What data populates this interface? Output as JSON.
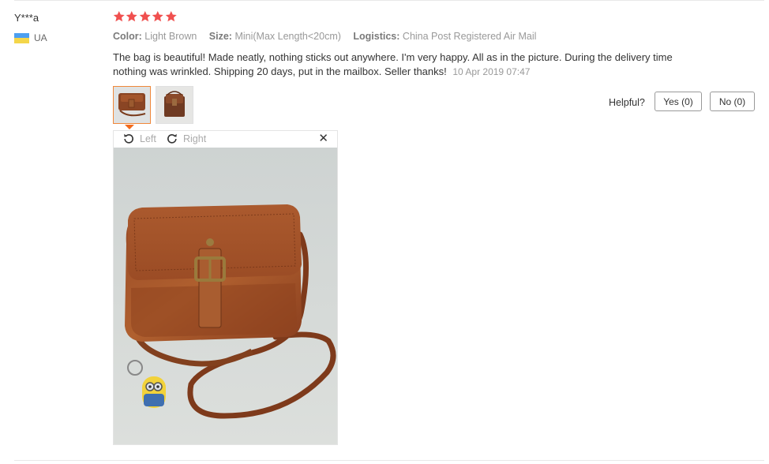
{
  "review": {
    "user_name": "Y***a",
    "country_code": "UA",
    "rating_stars": 5,
    "star_color": "#f0504f",
    "color_key": "Color:",
    "color_value": "Light Brown",
    "size_key": "Size:",
    "size_value": "Mini(Max Length<20cm)",
    "logistics_key": "Logistics:",
    "logistics_value": "China Post Registered Air Mail",
    "text": "The bag is beautiful! Made neatly, nothing sticks out anywhere. I'm very happy. All as in the picture. During the delivery time nothing was wrinkled. Shipping 20 days, put in the mailbox. Seller thanks!",
    "date": "10 Apr 2019 07:47"
  },
  "helpful": {
    "label": "Helpful?",
    "yes_label": "Yes (0)",
    "no_label": "No (0)"
  },
  "viewer": {
    "rotate_left_label": "Left",
    "rotate_right_label": "Right",
    "close_glyph": "✕"
  },
  "colors": {
    "active_thumb_border": "#f0883a",
    "pointer": "#f36b1c",
    "muted_text": "#999999"
  }
}
